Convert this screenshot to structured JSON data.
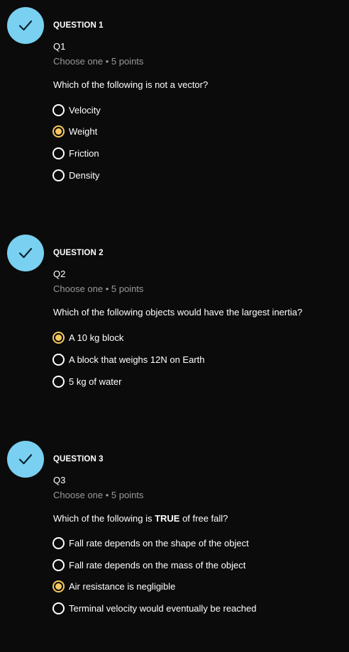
{
  "colors": {
    "background": "#0b0b0b",
    "check_circle": "#79d0f1",
    "selected_radio": "#f6c85f",
    "meta_text": "#9a9a9a"
  },
  "questions": [
    {
      "header": "QUESTION 1",
      "title": "Q1",
      "meta": "Choose one • 5 points",
      "prompt_before": "Which of the following is not a vector?",
      "prompt_bold": "",
      "prompt_after": "",
      "status_icon": "check-icon",
      "options": [
        {
          "label": "Velocity",
          "selected": false
        },
        {
          "label": "Weight",
          "selected": true
        },
        {
          "label": "Friction",
          "selected": false
        },
        {
          "label": "Density",
          "selected": false
        }
      ]
    },
    {
      "header": "QUESTION 2",
      "title": "Q2",
      "meta": "Choose one • 5 points",
      "prompt_before": "Which of the following objects would have the largest inertia?",
      "prompt_bold": "",
      "prompt_after": "",
      "status_icon": "check-icon",
      "options": [
        {
          "label": "A 10 kg block",
          "selected": true
        },
        {
          "label": "A block that weighs 12N on Earth",
          "selected": false
        },
        {
          "label": "5 kg of water",
          "selected": false
        }
      ]
    },
    {
      "header": "QUESTION 3",
      "title": "Q3",
      "meta": "Choose one • 5 points",
      "prompt_before": "Which of the following is ",
      "prompt_bold": "TRUE",
      "prompt_after": " of free fall?",
      "status_icon": "check-icon",
      "options": [
        {
          "label": "Fall rate depends on the shape of the object",
          "selected": false
        },
        {
          "label": "Fall rate depends on the mass of the object",
          "selected": false
        },
        {
          "label": "Air resistance is negligible",
          "selected": true
        },
        {
          "label": "Terminal velocity would eventually be reached",
          "selected": false
        }
      ]
    }
  ]
}
